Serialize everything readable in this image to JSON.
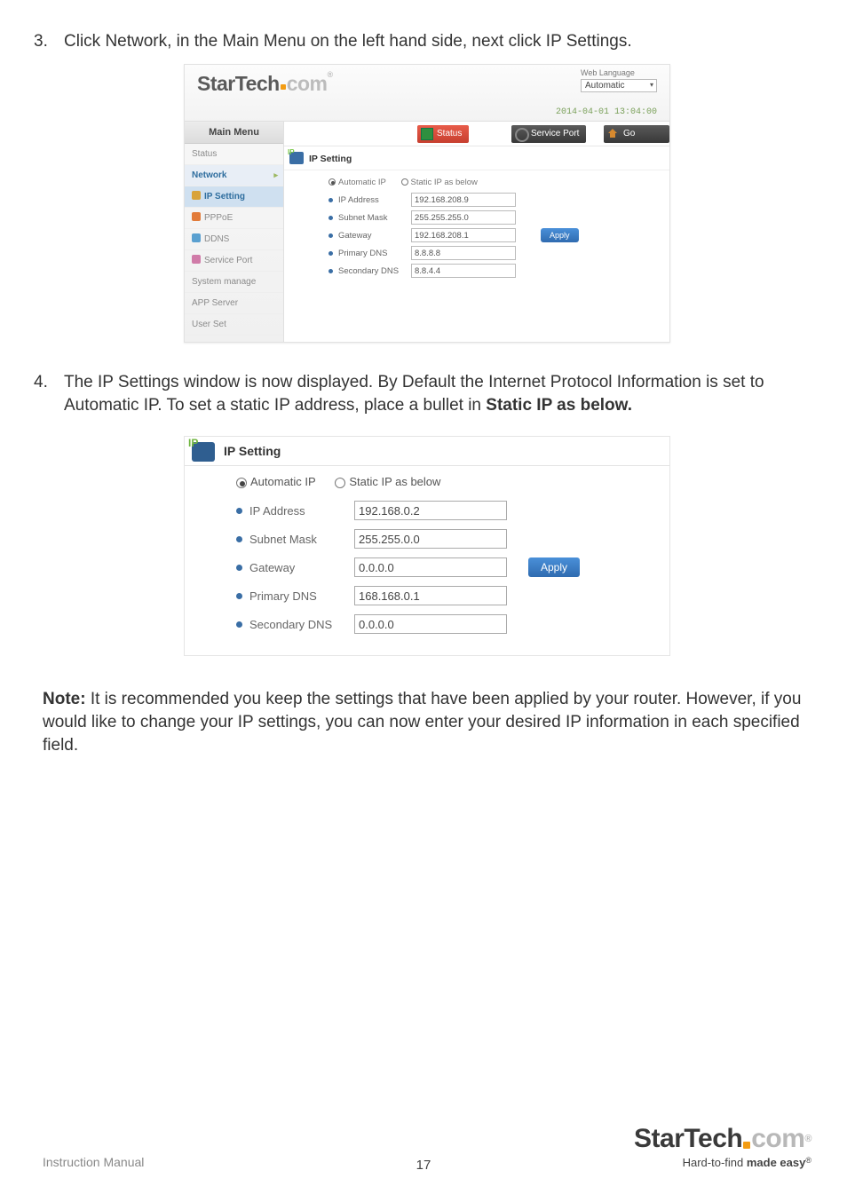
{
  "step3": {
    "num": "3.",
    "text": "Click Network, in the Main Menu on the left hand side, next click IP Settings."
  },
  "shot1": {
    "logo": {
      "part1": "StarTech",
      "part2": "com",
      "reg": "®"
    },
    "web_language": {
      "label": "Web Language",
      "value": "Automatic"
    },
    "timestamp": "2014-04-01 13:04:00",
    "main_menu_title": "Main Menu",
    "sidebar": {
      "status": "Status",
      "network": "Network",
      "ip_setting": "IP Setting",
      "pppoe": "PPPoE",
      "ddns": "DDNS",
      "service_port": "Service Port",
      "system_manage": "System manage",
      "app_server": "APP Server",
      "user_set": "User Set"
    },
    "topbar": {
      "status": "Status",
      "service_port": "Service Port",
      "go_home": "Go Home"
    },
    "panel_title": "IP Setting",
    "radio": {
      "auto": "Automatic IP",
      "static": "Static IP as below"
    },
    "fields": {
      "ip_label": "IP Address",
      "ip_value": "192.168.208.9",
      "sm_label": "Subnet Mask",
      "sm_value": "255.255.255.0",
      "gw_label": "Gateway",
      "gw_value": "192.168.208.1",
      "pdns_label": "Primary DNS",
      "pdns_value": "8.8.8.8",
      "sdns_label": "Secondary DNS",
      "sdns_value": "8.8.4.4"
    },
    "apply": "Apply"
  },
  "step4": {
    "num": "4.",
    "text_a": "The IP Settings window is now displayed.  By Default the Internet Protocol Information is set to Automatic IP. To set a static IP address, place a bullet in ",
    "text_bold": "Static IP as below."
  },
  "shot2": {
    "panel_title": "IP Setting",
    "radio": {
      "auto": "Automatic IP",
      "static": "Static IP as below"
    },
    "fields": {
      "ip_label": "IP Address",
      "ip_value": "192.168.0.2",
      "sm_label": "Subnet Mask",
      "sm_value": "255.255.0.0",
      "gw_label": "Gateway",
      "gw_value": "0.0.0.0",
      "pdns_label": "Primary DNS",
      "pdns_value": "168.168.0.1",
      "sdns_label": "Secondary DNS",
      "sdns_value": "0.0.0.0"
    },
    "apply": "Apply"
  },
  "note": {
    "lead": "Note:",
    "body": " It is recommended you keep the settings that have been applied by your router. However, if you would like to change your IP settings, you can now enter your desired IP information in each specified field."
  },
  "footer": {
    "instruction_manual": "Instruction Manual",
    "page_number": "17",
    "logo": {
      "part1": "StarTech",
      "part2": "com",
      "reg": "®"
    },
    "tagline_a": "Hard-to-find ",
    "tagline_b": "made easy",
    "tagline_reg": "®"
  }
}
